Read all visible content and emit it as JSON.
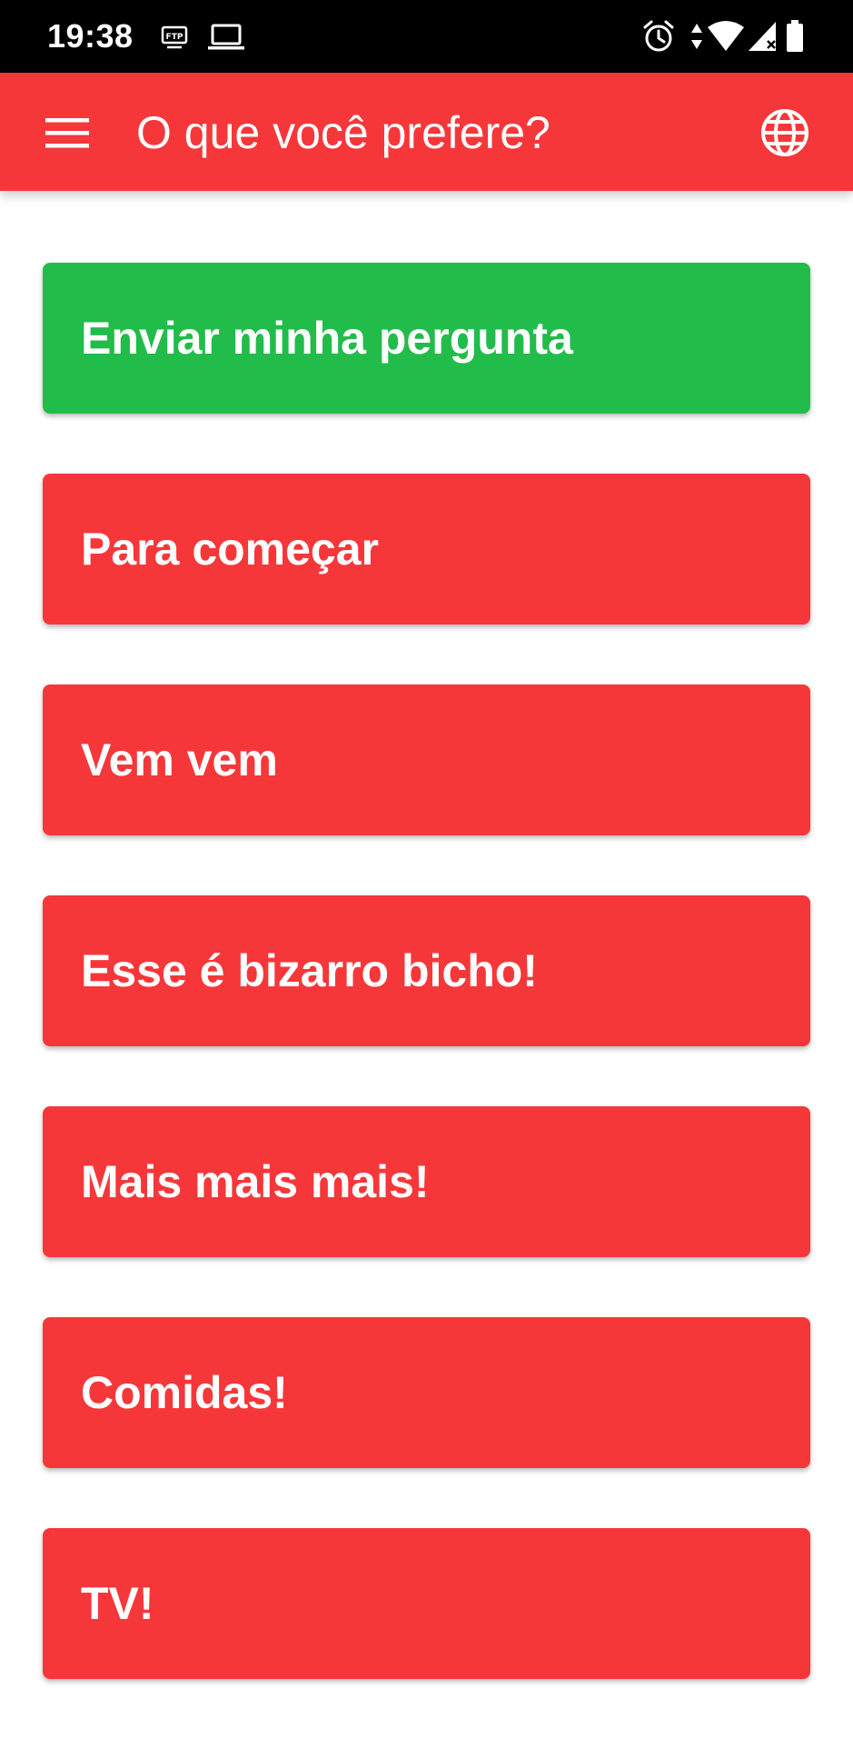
{
  "status_bar": {
    "time": "19:38",
    "left_icons": [
      "ftp-icon",
      "laptop-icon"
    ],
    "right_icons": [
      "alarm-icon",
      "data-arrows-icon",
      "wifi-icon",
      "cell-signal-icon",
      "battery-icon"
    ],
    "ftp_label": "FTP"
  },
  "app_bar": {
    "title": "O que você prefere?",
    "menu_icon": "hamburger-menu-icon",
    "language_icon": "globe-icon"
  },
  "colors": {
    "app_bar": "#f6373a",
    "category_button": "#f6373a",
    "submit_button": "#22bc4a",
    "text": "#ffffff",
    "status_bar": "#000000"
  },
  "buttons": {
    "submit": "Enviar minha pergunta",
    "categories": [
      "Para começar",
      "Vem vem",
      "Esse é bizarro bicho!",
      "Mais mais mais!",
      "Comidas!",
      "TV!"
    ]
  }
}
